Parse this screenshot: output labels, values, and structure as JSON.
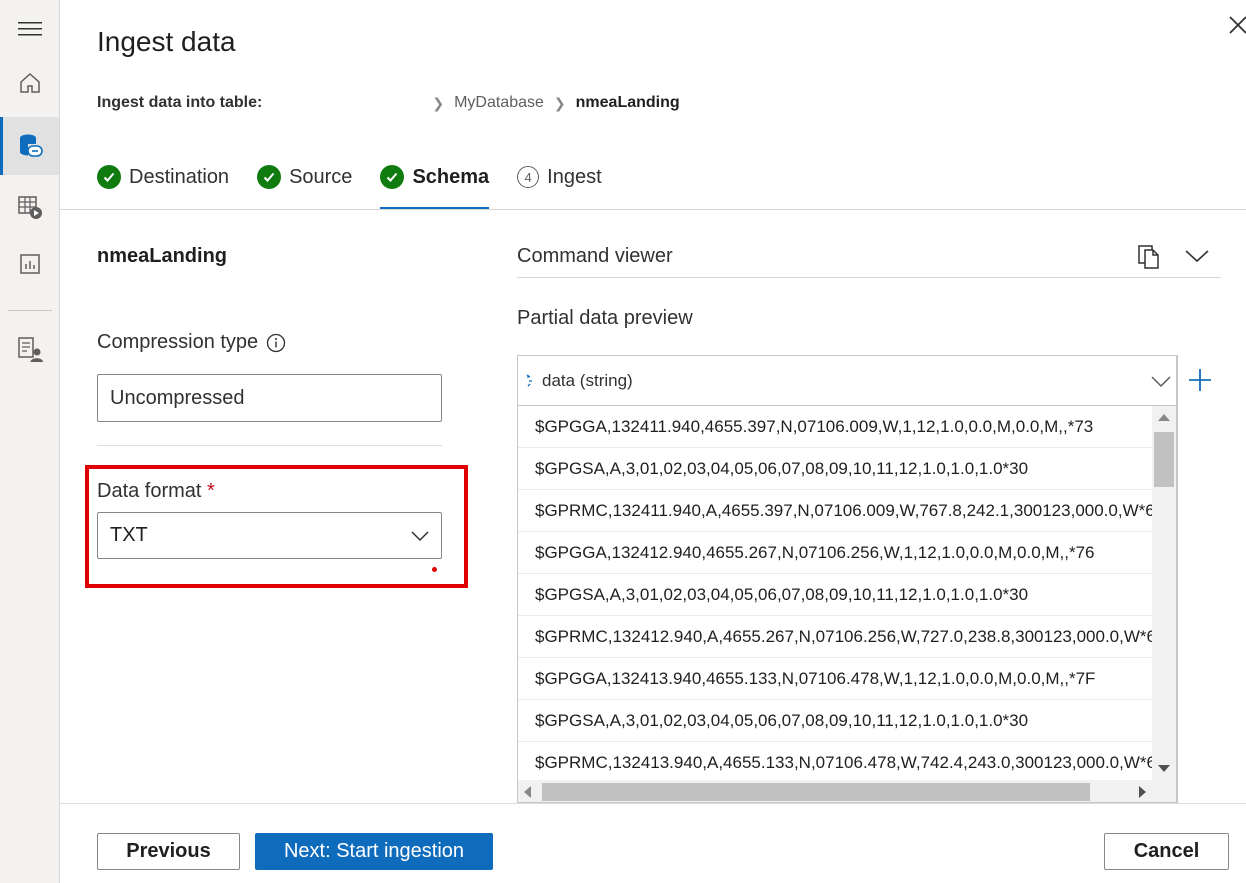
{
  "rail": {
    "items": [
      {
        "icon": "hamburger-icon"
      },
      {
        "icon": "home-icon"
      },
      {
        "icon": "database-link-icon",
        "active": true
      },
      {
        "icon": "table-play-icon"
      },
      {
        "icon": "chart-icon"
      },
      {
        "icon": "user-document-icon"
      }
    ]
  },
  "header": {
    "title": "Ingest data",
    "close_icon": "close-icon"
  },
  "breadcrumb": {
    "label": "Ingest data into table:",
    "database": "MyDatabase",
    "table": "nmeaLanding"
  },
  "tabs": [
    {
      "label": "Destination",
      "state": "done"
    },
    {
      "label": "Source",
      "state": "done"
    },
    {
      "label": "Schema",
      "state": "selected"
    },
    {
      "label": "Ingest",
      "state": "pending",
      "number": "4"
    }
  ],
  "left": {
    "table_name": "nmeaLanding",
    "compression_label": "Compression type",
    "compression_value": "Uncompressed",
    "format_label": "Data format",
    "format_required": "*",
    "format_value": "TXT"
  },
  "right": {
    "command_viewer": "Command viewer",
    "preview_title": "Partial data preview",
    "column_header": "data (string)",
    "rows": [
      "$GPGGA,132411.940,4655.397,N,07106.009,W,1,12,1.0,0.0,M,0.0,M,,*73",
      "$GPGSA,A,3,01,02,03,04,05,06,07,08,09,10,11,12,1.0,1.0,1.0*30",
      "$GPRMC,132411.940,A,4655.397,N,07106.009,W,767.8,242.1,300123,000.0,W*6",
      "$GPGGA,132412.940,4655.267,N,07106.256,W,1,12,1.0,0.0,M,0.0,M,,*76",
      "$GPGSA,A,3,01,02,03,04,05,06,07,08,09,10,11,12,1.0,1.0,1.0*30",
      "$GPRMC,132412.940,A,4655.267,N,07106.256,W,727.0,238.8,300123,000.0,W*6",
      "$GPGGA,132413.940,4655.133,N,07106.478,W,1,12,1.0,0.0,M,0.0,M,,*7F",
      "$GPGSA,A,3,01,02,03,04,05,06,07,08,09,10,11,12,1.0,1.0,1.0*30",
      "$GPRMC,132413.940,A,4655.133,N,07106.478,W,742.4,243.0,300123,000.0,W*6"
    ]
  },
  "footer": {
    "previous": "Previous",
    "next": "Next: Start ingestion",
    "cancel": "Cancel"
  },
  "colors": {
    "accent": "#0f6cbd",
    "success": "#107c10",
    "highlight": "#e00000"
  }
}
